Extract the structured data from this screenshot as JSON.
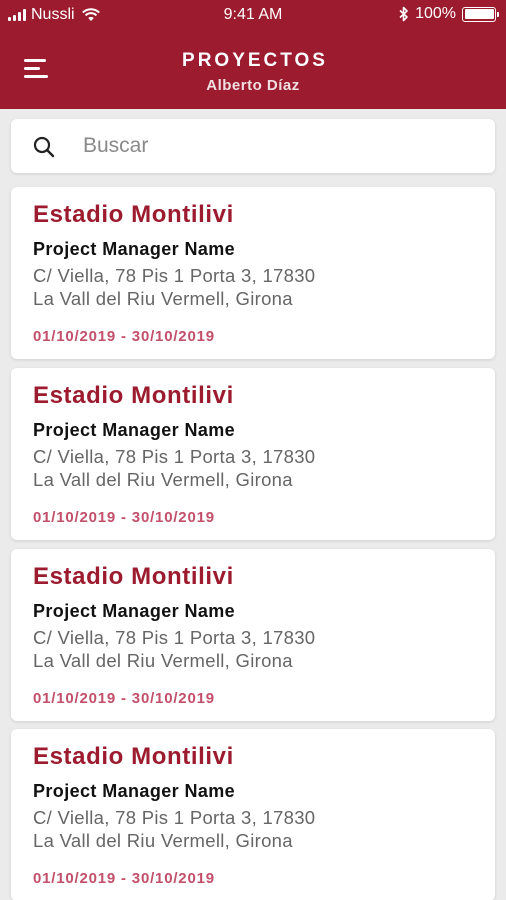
{
  "status_bar": {
    "carrier": "Nussli",
    "time": "9:41 AM",
    "battery": "100%",
    "icons": [
      "signal-icon",
      "wifi-icon",
      "bluetooth-icon",
      "battery-icon"
    ]
  },
  "header": {
    "title": "PROYECTOS",
    "subtitle": "Alberto Díaz",
    "menu_icon": "hamburger-menu-icon",
    "background_color": "#9c1b2e"
  },
  "search": {
    "placeholder": "Buscar",
    "value": "",
    "icon": "search-icon"
  },
  "projects": [
    {
      "name": "Estadio Montilivi",
      "manager": "Project Manager Name",
      "address_line1": "C/ Viella, 78 Pis 1 Porta 3, 17830",
      "address_line2": "La Vall del Riu Vermell, Girona",
      "dates": "01/10/2019 - 30/10/2019"
    },
    {
      "name": "Estadio Montilivi",
      "manager": "Project Manager Name",
      "address_line1": "C/ Viella, 78 Pis 1 Porta 3, 17830",
      "address_line2": "La Vall del Riu Vermell, Girona",
      "dates": "01/10/2019 - 30/10/2019"
    },
    {
      "name": "Estadio Montilivi",
      "manager": "Project Manager Name",
      "address_line1": "C/ Viella, 78 Pis 1 Porta 3, 17830",
      "address_line2": "La Vall del Riu Vermell, Girona",
      "dates": "01/10/2019 - 30/10/2019"
    },
    {
      "name": "Estadio Montilivi",
      "manager": "Project Manager Name",
      "address_line1": "C/ Viella, 78 Pis 1 Porta 3, 17830",
      "address_line2": "La Vall del Riu Vermell, Girona",
      "dates": "01/10/2019 - 30/10/2019"
    }
  ],
  "colors": {
    "brand": "#9c1b2e",
    "date_text": "#c3506a",
    "background": "#ecebeb"
  }
}
